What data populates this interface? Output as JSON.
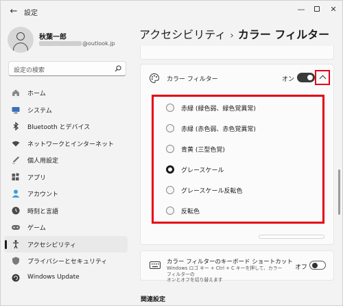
{
  "window": {
    "title": "設定",
    "back_glyph": "←",
    "min_glyph": "—",
    "close_glyph": "✕"
  },
  "profile": {
    "name": "秋葉一郎",
    "email_suffix": "@outlook.jp"
  },
  "search": {
    "placeholder": "設定の検索"
  },
  "nav": {
    "items": [
      {
        "label": "ホーム",
        "icon": "home-icon"
      },
      {
        "label": "システム",
        "icon": "monitor-icon"
      },
      {
        "label": "Bluetooth とデバイス",
        "icon": "bluetooth-icon"
      },
      {
        "label": "ネットワークとインターネット",
        "icon": "wifi-icon"
      },
      {
        "label": "個人用設定",
        "icon": "pen-icon"
      },
      {
        "label": "アプリ",
        "icon": "apps-icon"
      },
      {
        "label": "アカウント",
        "icon": "account-icon"
      },
      {
        "label": "時刻と言語",
        "icon": "clock-globe-icon"
      },
      {
        "label": "ゲーム",
        "icon": "gamepad-icon"
      },
      {
        "label": "アクセシビリティ",
        "icon": "accessibility-icon",
        "active": true
      },
      {
        "label": "プライバシーとセキュリティ",
        "icon": "shield-icon"
      },
      {
        "label": "Windows Update",
        "icon": "update-icon"
      }
    ]
  },
  "breadcrumb": {
    "parent": "アクセシビリティ",
    "separator": "›",
    "current": "カラー フィルター"
  },
  "color_filter": {
    "title": "カラー フィルター",
    "toggle_label": "オン",
    "toggle_on": true,
    "options": [
      {
        "label": "赤緑 (緑色弱、緑色覚異常)",
        "checked": false
      },
      {
        "label": "赤緑 (赤色弱、赤色覚異常)",
        "checked": false
      },
      {
        "label": "青黄 (三型色覚)",
        "checked": false
      },
      {
        "label": "グレースケール",
        "checked": true
      },
      {
        "label": "グレースケール反転色",
        "checked": false
      },
      {
        "label": "反転色",
        "checked": false
      }
    ]
  },
  "shortcut": {
    "title": "カラー フィルターのキーボード ショートカット",
    "desc_line1": "Windows ロゴ キー + Ctrl + C キーを押して、カラー フィルターの",
    "desc_line2": "オンとオフを切り替えます",
    "toggle_label": "オフ",
    "toggle_on": false
  },
  "related": {
    "title": "関連設定"
  },
  "colors": {
    "highlight_red": "#e60012",
    "toggle_dark": "#3a3a3a",
    "background": "#f3f3f3",
    "card": "#fbfbfb"
  }
}
